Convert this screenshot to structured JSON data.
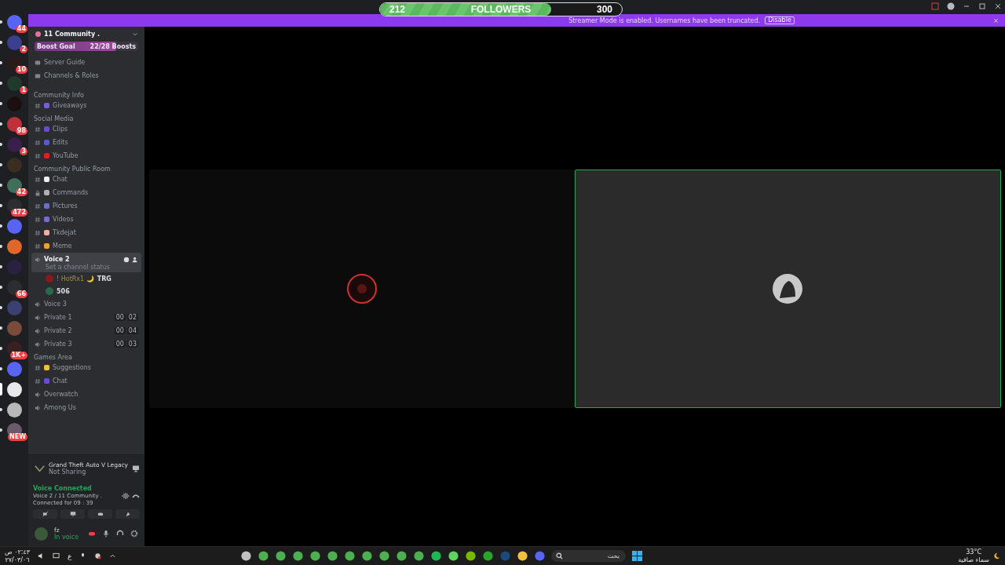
{
  "followers_bar": {
    "current": "212",
    "label": "FOLLOWERS",
    "goal": "300",
    "level": 0.707
  },
  "banner": {
    "text": "Streamer Mode is enabled. Usernames have been truncated.",
    "button": "Disable"
  },
  "servers": [
    {
      "badge": "44",
      "color": "#5865f2",
      "selected": false
    },
    {
      "badge": "2",
      "color": "#3a3f8f",
      "selected": false
    },
    {
      "badge": "10",
      "color": "#2a1a1a",
      "selected": false
    },
    {
      "badge": "1",
      "color": "#1f3a2a",
      "selected": false
    },
    {
      "color": "#1a1010",
      "selected": false
    },
    {
      "badge": "98",
      "color": "#c0303a",
      "selected": false
    },
    {
      "badge": "3",
      "color": "#3a1f4a",
      "selected": false
    },
    {
      "color": "#3a2e20",
      "selected": false
    },
    {
      "badge": "42",
      "color": "#3f6f5a",
      "selected": false
    },
    {
      "badge": "472",
      "color": "#2b2d31",
      "selected": false
    },
    {
      "color": "#5865f2",
      "selected": false
    },
    {
      "color": "#e0672a",
      "selected": false
    },
    {
      "color": "#2a2040",
      "selected": false
    },
    {
      "badge": "66",
      "color": "#2b2d31",
      "selected": false
    },
    {
      "color": "#3a4070",
      "selected": false
    },
    {
      "color": "#7a4a3a",
      "selected": false
    },
    {
      "badge": "1K+",
      "color": "#3a2020",
      "selected": false
    },
    {
      "color": "#5865f2",
      "selected": false
    },
    {
      "color": "#e8e8e8",
      "selected": true
    },
    {
      "color": "#b8b8b8",
      "selected": false
    },
    {
      "badge": "NEW",
      "color": "#6a5a6a",
      "selected": false
    }
  ],
  "server": {
    "name": "11 Community .",
    "boost": {
      "label": "Boost Goal",
      "count": "22/28 Boosts",
      "level": 0.79
    }
  },
  "channels": [
    {
      "kind": "link",
      "name": "Server Guide"
    },
    {
      "kind": "link",
      "name": "Channels & Roles"
    },
    {
      "kind": "category",
      "name": "Community Info"
    },
    {
      "kind": "text",
      "name": "Giveaways",
      "color": "#7a5cd6",
      "selected": false
    },
    {
      "kind": "category",
      "name": "Social Media"
    },
    {
      "kind": "text",
      "name": "Clips",
      "color": "#6a4ccf",
      "selected": false
    },
    {
      "kind": "text",
      "name": "Edits",
      "color": "#5a5ad0",
      "selected": false
    },
    {
      "kind": "text",
      "name": "YouTube",
      "color": "#e02020",
      "selected": false
    },
    {
      "kind": "category",
      "name": "Community Public Room"
    },
    {
      "kind": "text",
      "name": "Chat",
      "color": "#f0f0f0",
      "selected": false
    },
    {
      "kind": "locked",
      "name": "Commands",
      "color": "#b0b0b0",
      "selected": false
    },
    {
      "kind": "text",
      "name": "Pictures",
      "color": "#6a70c0",
      "selected": false
    },
    {
      "kind": "text",
      "name": "Videos",
      "color": "#7a6ad0",
      "selected": false
    },
    {
      "kind": "text",
      "name": "Tkdejat",
      "color": "#f0b0a0",
      "selected": false
    },
    {
      "kind": "text",
      "name": "Meme",
      "color": "#f0a030",
      "selected": false
    },
    {
      "kind": "voice",
      "name": "Voice 2",
      "status": "Set a channel status",
      "selected": true
    },
    {
      "kind": "user",
      "name": "! HotRx1 🌙",
      "tag": "TRG",
      "color": "#8a1a1a"
    },
    {
      "kind": "user",
      "tag": "506",
      "color": "#2a6a4a"
    },
    {
      "kind": "voice",
      "name": "Voice 3",
      "selected": false
    },
    {
      "kind": "voice",
      "name": "Private 1",
      "counts": [
        "00",
        "02"
      ],
      "selected": false
    },
    {
      "kind": "voice",
      "name": "Private 2",
      "counts": [
        "00",
        "04"
      ],
      "selected": false
    },
    {
      "kind": "voice",
      "name": "Private 3",
      "counts": [
        "00",
        "03"
      ],
      "selected": false
    },
    {
      "kind": "category",
      "name": "Games Area"
    },
    {
      "kind": "text",
      "name": "Suggestions",
      "color": "#f0c030",
      "selected": false
    },
    {
      "kind": "text",
      "name": "Chat",
      "color": "#6a4ccf",
      "selected": false
    },
    {
      "kind": "voice",
      "name": "Overwatch",
      "selected": false
    },
    {
      "kind": "voice",
      "name": "Among Us",
      "selected": false
    }
  ],
  "activity": {
    "game": "Grand Theft Auto V Legacy",
    "status": "Not Sharing"
  },
  "voice": {
    "title": "Voice Connected",
    "channel": "Voice 2 / 11 Community .",
    "duration": "Connected for 09 : 39"
  },
  "user": {
    "name": "fz",
    "status": "In voice",
    "deafened": true
  },
  "taskbar": {
    "time": "٠٢:٤٣ ص",
    "date": "٢٧/٠٣/٠٦",
    "lang": "ع",
    "search_placeholder": "بحث",
    "temperature": "33°C",
    "weather": "سماء صافية"
  }
}
